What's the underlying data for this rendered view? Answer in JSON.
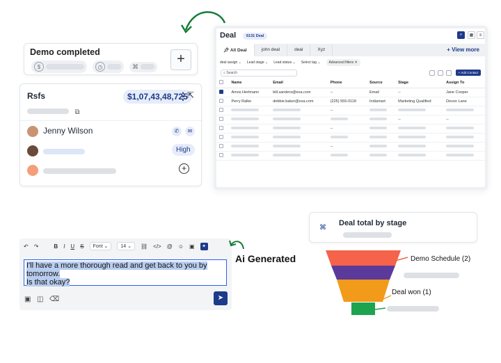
{
  "demo_card": {
    "title": "Demo completed",
    "add_label": "+"
  },
  "rsfs_card": {
    "title": "Rsfs",
    "amount": "$1,07,43,48,725",
    "contact_name": "Jenny Wilson",
    "priority": "High"
  },
  "deal_window": {
    "title": "Deal",
    "count_badge": "6131 Deal",
    "tabs": [
      "All Deal",
      "john deal",
      "deal",
      "Xyz"
    ],
    "view_more": "View more",
    "filters": [
      "deal assign",
      "Lead stage",
      "Lead status",
      "Select tag",
      "Advanced filters"
    ],
    "search_placeholder": "Search",
    "add_contact": "+ Add Contact",
    "columns": [
      "Name",
      "Email",
      "Phone",
      "Source",
      "Stage",
      "Assign To"
    ],
    "rows": [
      {
        "name": "Amos Hertmann",
        "email": "bill.sanders@exa.com",
        "phone": "--",
        "source": "Email",
        "stage": "--",
        "assign": "Jane Cooper"
      },
      {
        "name": "Perry Ralke",
        "email": "debbie.baker@exa.com",
        "phone": "(225) 555-0118",
        "source": "Indiamart",
        "stage": "Marketing Qualified",
        "assign": "Devon Lane"
      }
    ],
    "placeholder_row_texts": [
      "--",
      "--",
      "--",
      "--",
      "--"
    ]
  },
  "editor": {
    "font_label": "Font",
    "size_label": "14",
    "text_line1": "I'll have a more thorough read and get back to you by",
    "text_line2": "tomorrow.",
    "text_line3": "Is that okay?"
  },
  "ai_label": "Ai Generated",
  "stage_card": {
    "title": "Deal total by stage",
    "stage1": "Demo Schedule (2)",
    "stage2": "Deal won (1)"
  },
  "colors": {
    "accent": "#1e3a8a",
    "funnel": [
      "#f4634a",
      "#5b3a9c",
      "#f29a1a",
      "#1ea34e"
    ],
    "arrow": "#167d3a"
  }
}
